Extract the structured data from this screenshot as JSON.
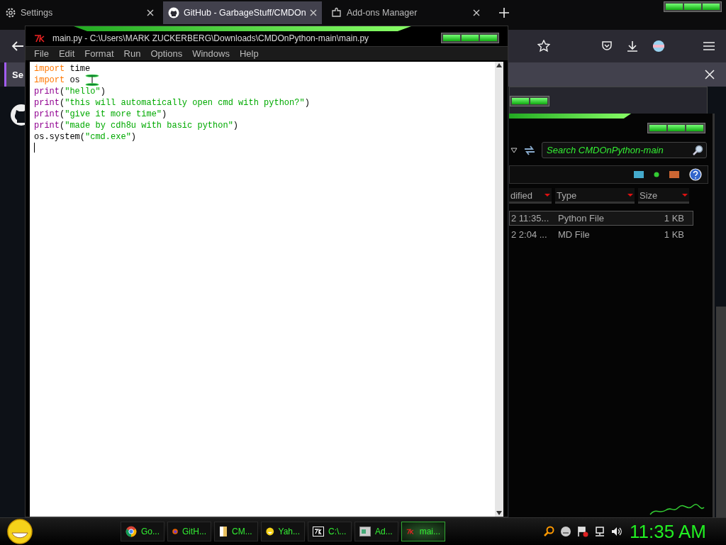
{
  "browser": {
    "tabs": [
      {
        "label": "Settings",
        "selected": false
      },
      {
        "label": "GitHub - GarbageStuff/CMDOn",
        "selected": true
      },
      {
        "label": "Add-ons Manager",
        "selected": false
      }
    ],
    "notification": {
      "text": "Se"
    }
  },
  "editor": {
    "title": "main.py - C:\\Users\\MARK ZUCKERBERG\\Downloads\\CMDOnPython-main\\main.py",
    "menu": [
      "File",
      "Edit",
      "Format",
      "Run",
      "Options",
      "Windows",
      "Help"
    ],
    "lines": [
      {
        "tokens": [
          {
            "kind": "keyword",
            "text": "import"
          },
          {
            "kind": "plain",
            "text": " time"
          }
        ]
      },
      {
        "tokens": [
          {
            "kind": "keyword",
            "text": "import"
          },
          {
            "kind": "plain",
            "text": " os"
          }
        ]
      },
      {
        "tokens": [
          {
            "kind": "builtin",
            "text": "print"
          },
          {
            "kind": "plain",
            "text": "("
          },
          {
            "kind": "string",
            "text": "\"hello\""
          },
          {
            "kind": "plain",
            "text": ")"
          }
        ]
      },
      {
        "tokens": [
          {
            "kind": "builtin",
            "text": "print"
          },
          {
            "kind": "plain",
            "text": "("
          },
          {
            "kind": "string",
            "text": "\"this will automatically open cmd with python?\""
          },
          {
            "kind": "plain",
            "text": ")"
          }
        ]
      },
      {
        "tokens": [
          {
            "kind": "builtin",
            "text": "print"
          },
          {
            "kind": "plain",
            "text": "("
          },
          {
            "kind": "string",
            "text": "\"give it more time\""
          },
          {
            "kind": "plain",
            "text": ")"
          }
        ]
      },
      {
        "tokens": [
          {
            "kind": "builtin",
            "text": "print"
          },
          {
            "kind": "plain",
            "text": "("
          },
          {
            "kind": "string",
            "text": "\"made by cdh8u with basic python\""
          },
          {
            "kind": "plain",
            "text": ")"
          }
        ]
      },
      {
        "tokens": [
          {
            "kind": "plain",
            "text": "os.system("
          },
          {
            "kind": "string",
            "text": "\"cmd.exe\""
          },
          {
            "kind": "plain",
            "text": ")"
          }
        ]
      }
    ]
  },
  "explorer": {
    "search": {
      "placeholder": "Search CMDOnPython-main"
    },
    "columns": [
      "dified",
      "Type",
      "Size"
    ],
    "rows": [
      {
        "modified": "2 11:35...",
        "type": "Python File",
        "size": "1 KB",
        "selected": true
      },
      {
        "modified": "2 2:04 ...",
        "type": "MD File",
        "size": "1 KB",
        "selected": false
      }
    ]
  },
  "taskbar": {
    "items": [
      {
        "label": "Go...",
        "selected": false
      },
      {
        "label": "GitH...",
        "selected": false
      },
      {
        "label": "CM...",
        "selected": false
      },
      {
        "label": "Yah...",
        "selected": false
      },
      {
        "label": "C:\\...",
        "selected": false
      },
      {
        "label": "Ad...",
        "selected": false
      },
      {
        "label": "mai...",
        "selected": true
      }
    ],
    "clock": "11:35 AM"
  }
}
